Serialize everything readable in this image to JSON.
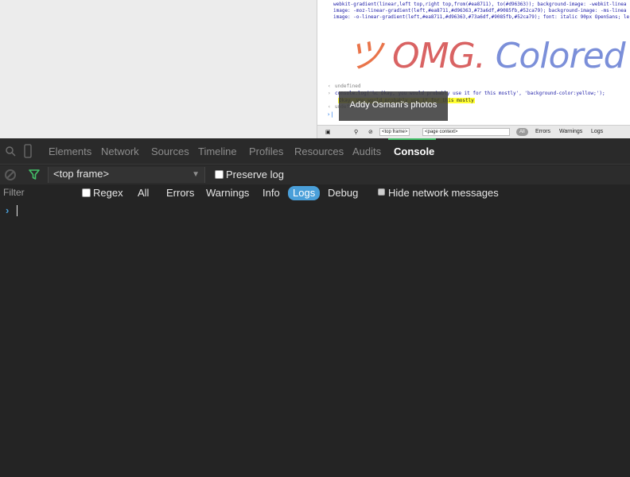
{
  "page": {
    "code_lines": [
      "webkit-gradient(linear,left top,right top,from(#ea8711), to(#d96363)); background-image: -webkit-linea",
      "image: -moz-linear-gradient(left,#ea8711,#d96363,#73a6df,#9085fb,#52ca79); background-image: -ms-linea",
      "image: -o-linear-gradient(left,#ea8711,#d96363,#73a6df,#9085fb,#52ca79); font: italic 90px OpenSans; le"
    ],
    "banner": {
      "glyph": "ツ",
      "word1": "OMG.",
      "word2": "Colored"
    },
    "console_lines": {
      "undefined_1": "undefined",
      "command": "console.log('%c Okay, you would probably use it for this mostly', 'background-color:yellow;');",
      "output": "Okay, you would probably use it for this mostly",
      "undefined_2": "undefined",
      "prompt": "|"
    },
    "mini_toolbar": {
      "frame": "<top frame>",
      "context": "<page context>",
      "all": "All",
      "errors": "Errors",
      "warnings": "Warnings",
      "logs": "Logs"
    },
    "tooltip": "Addy Osmani's photos"
  },
  "tabs": [
    "Elements",
    "Network",
    "Sources",
    "Timeline",
    "Profiles",
    "Resources",
    "Audits",
    "Console"
  ],
  "active_tab": "Console",
  "console_toolbar": {
    "frame_select": "<top frame>",
    "preserve_log": "Preserve log"
  },
  "filter_bar": {
    "label": "Filter",
    "regex": "Regex",
    "levels": [
      "All",
      "Errors",
      "Warnings",
      "Info",
      "Logs",
      "Debug"
    ],
    "selected_level": "Logs",
    "hide_network": "Hide network messages"
  },
  "console": {
    "prompt_symbol": "›"
  },
  "colors": {
    "accent_green": "#43c168",
    "selected_blue": "#4a9fd9",
    "panel_bg": "#242424"
  }
}
